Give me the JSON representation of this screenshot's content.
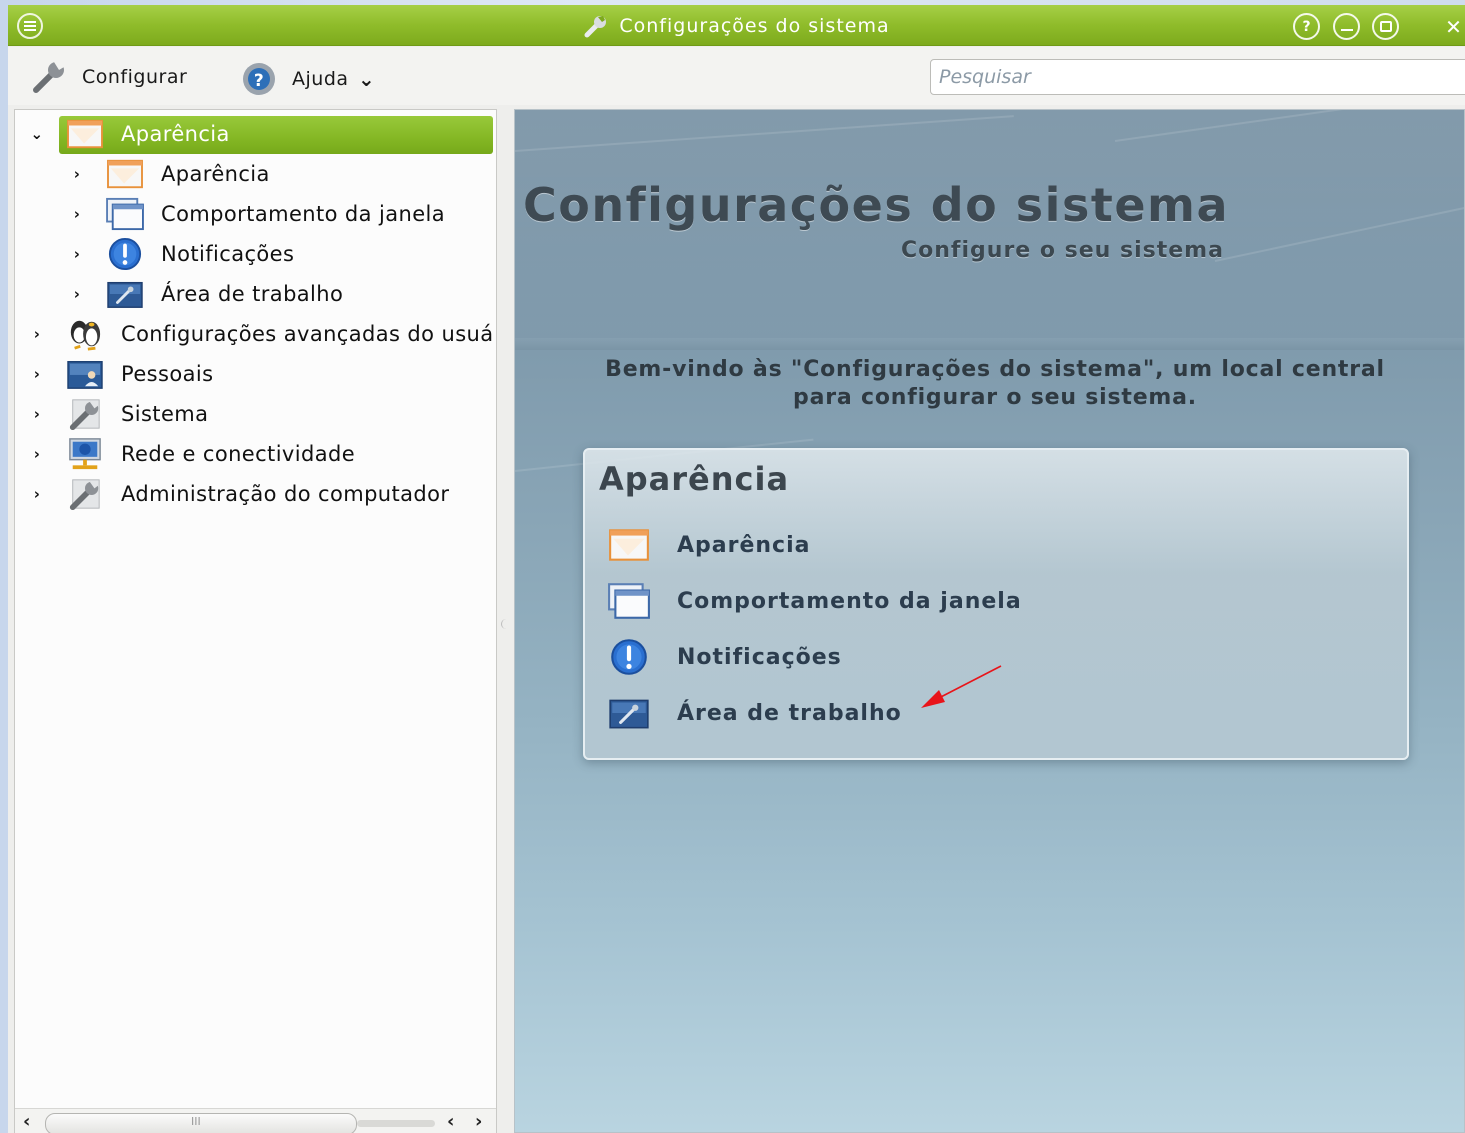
{
  "window": {
    "title": "Configurações do sistema",
    "buttons": {
      "help": "?",
      "minimize": "–",
      "maximize": "□",
      "close": "✕"
    }
  },
  "toolbar": {
    "configure_label": "Configurar",
    "help_label": "Ajuda",
    "help_dropdown": "⌄",
    "search_placeholder": "Pesquisar"
  },
  "sidebar": {
    "items": [
      {
        "label": "Aparência",
        "level": 0,
        "expanded": true,
        "selected": true,
        "icon": "appearance-icon",
        "arrow": "⌄"
      },
      {
        "label": "Aparência",
        "level": 1,
        "icon": "appearance-icon",
        "arrow": "›"
      },
      {
        "label": "Comportamento da janela",
        "level": 1,
        "icon": "window-behavior-icon",
        "arrow": "›"
      },
      {
        "label": "Notificações",
        "level": 1,
        "icon": "notifications-icon",
        "arrow": "›"
      },
      {
        "label": "Área de trabalho",
        "level": 1,
        "icon": "workspace-icon",
        "arrow": "›"
      },
      {
        "label": "Configurações avançadas do usuário",
        "level": 0,
        "icon": "advanced-user-icon",
        "arrow": "›"
      },
      {
        "label": "Pessoais",
        "level": 0,
        "icon": "personal-icon",
        "arrow": "›"
      },
      {
        "label": "Sistema",
        "level": 0,
        "icon": "system-icon",
        "arrow": "›"
      },
      {
        "label": "Rede e conectividade",
        "level": 0,
        "icon": "network-icon",
        "arrow": "›"
      },
      {
        "label": "Administração do computador",
        "level": 0,
        "icon": "admin-icon",
        "arrow": "›"
      }
    ],
    "scroll": {
      "left": "‹",
      "right": "›",
      "thumb_grip": "III"
    }
  },
  "main": {
    "title": "Configurações do sistema",
    "subtitle": "Configure o seu sistema",
    "welcome_line1": "Bem-vindo às \"Configurações do sistema\", um local central",
    "welcome_line2": "para configurar o seu sistema.",
    "panel": {
      "title": "Aparência",
      "items": [
        {
          "label": "Aparência",
          "icon": "appearance-icon"
        },
        {
          "label": "Comportamento da janela",
          "icon": "window-behavior-icon"
        },
        {
          "label": "Notificações",
          "icon": "notifications-icon"
        },
        {
          "label": "Área de trabalho",
          "icon": "workspace-icon"
        }
      ]
    }
  },
  "colors": {
    "accent_green": "#8fbc2a",
    "annotation_arrow": "#e8141a"
  }
}
